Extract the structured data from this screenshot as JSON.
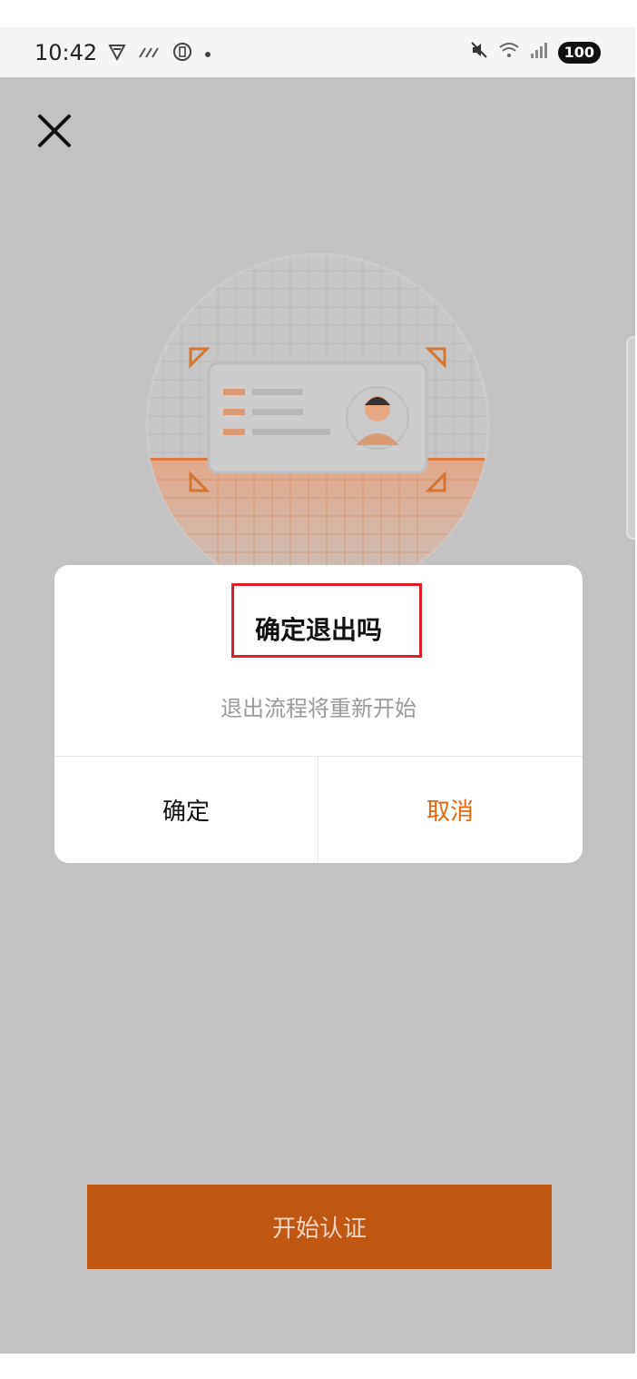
{
  "status_bar": {
    "time": "10:42",
    "battery": "100"
  },
  "dialog": {
    "title": "确定退出吗",
    "message": "退出流程将重新开始",
    "confirm_label": "确定",
    "cancel_label": "取消"
  },
  "start_button": {
    "label": "开始认证"
  },
  "colors": {
    "accent": "#e8640d",
    "primary_button": "#c05713",
    "overlay_background": "#c2c2c2",
    "highlight_border": "#e21b2b"
  },
  "icons": {
    "close": "close-icon",
    "id_card": "id-card-illustration"
  }
}
